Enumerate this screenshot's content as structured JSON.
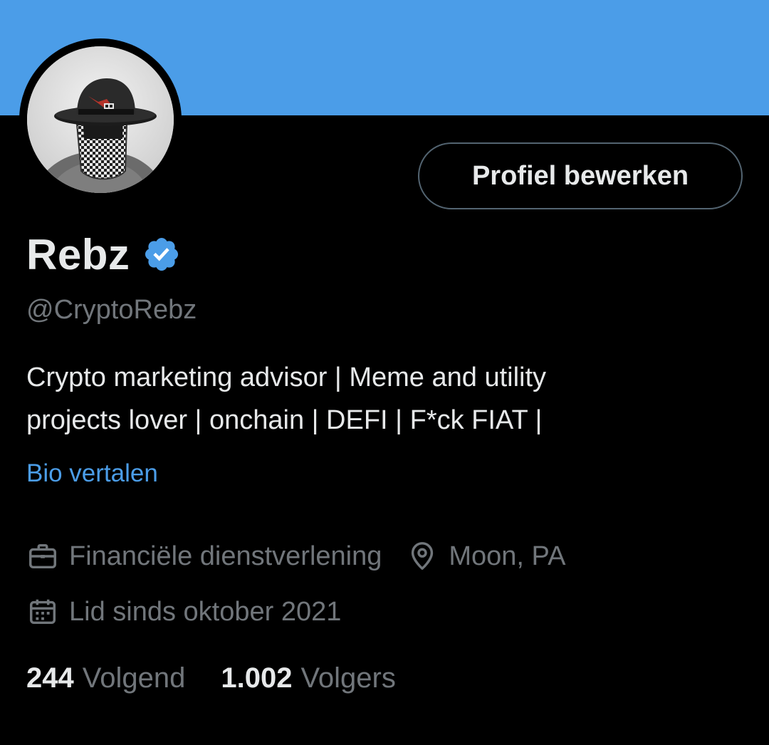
{
  "colors": {
    "banner": "#4b9de8",
    "background": "#000000",
    "primary_text": "#e7e9ea",
    "secondary_text": "#71767b",
    "link": "#4b9de8",
    "verified_badge": "#4b9de8",
    "button_border": "#536471"
  },
  "avatar": {
    "icon": "profile-photo-masked-figure-with-bowler-hat"
  },
  "profile": {
    "edit_button_label": "Profiel bewerken",
    "display_name": "Rebz",
    "verified_icon": "verified-badge-icon",
    "handle": "@CryptoRebz",
    "bio_lines": [
      "Crypto marketing advisor | Meme and utility",
      "projects lover | onchain | DEFI | F*ck FIAT |"
    ],
    "translate_label": "Bio vertalen"
  },
  "meta": {
    "category": {
      "icon": "briefcase-icon",
      "text": "Financiële dienstverlening"
    },
    "location": {
      "icon": "location-pin-icon",
      "text": "Moon, PA"
    },
    "joined": {
      "icon": "calendar-icon",
      "text": "Lid sinds oktober 2021"
    }
  },
  "stats": {
    "following": {
      "count": "244",
      "label": "Volgend"
    },
    "followers": {
      "count": "1.002",
      "label": "Volgers"
    }
  }
}
